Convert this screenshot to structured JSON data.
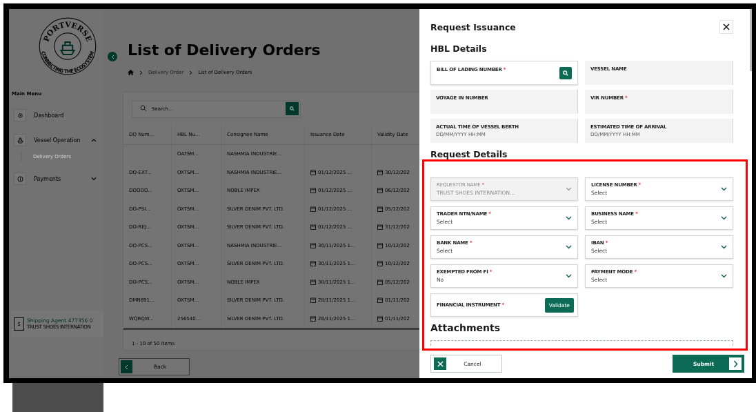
{
  "sidebar": {
    "logo": {
      "top_text": "PORTVERSE",
      "bottom_text": "CONNECTING THE ECOSYSTEM"
    },
    "menu_title": "Main Menu",
    "items": [
      {
        "label": "Dashboard",
        "kind": "dashboard"
      },
      {
        "label": "Vessel Operation",
        "kind": "ship",
        "expanded": true,
        "children": [
          {
            "label": "Delivery Orders"
          }
        ]
      },
      {
        "label": "Payments",
        "kind": "payment",
        "expanded": false
      }
    ],
    "user": {
      "avatar": "s",
      "name": "Shipping Agent 477356 0",
      "company": "TRUST SHOES INTERNATION"
    }
  },
  "page": {
    "title": "List of Delivery Orders",
    "breadcrumb": [
      "Delivery Order",
      "List of Delivery Orders"
    ],
    "search": {
      "placeholder": "Search..."
    },
    "table": {
      "columns": [
        "DO Num...",
        "HBL Nu...",
        "Consignee Name",
        "Issuance Date",
        "Validity Date"
      ],
      "rows": [
        {
          "hbl_number": "OATSM...",
          "consignee": "NASHMIA INDUSTRIE..."
        },
        {
          "do_number": "DO-EXT...",
          "hbl_number": "OXTSM...",
          "consignee": "NASHMIA INDUSTRIE...",
          "issuance_date": "01/12/2025 ...",
          "validity_date": "30/12/202"
        },
        {
          "do_number": "DOOOO...",
          "hbl_number": "OXTSM...",
          "consignee": "NOBLE IMPEX",
          "issuance_date": "01/12/2025 ...",
          "validity_date": "06/12/202"
        },
        {
          "do_number": "DO-PSI...",
          "hbl_number": "OXTSM...",
          "consignee": "SILVER DENIM PVT. LTD.",
          "issuance_date": "01/12/2025 ...",
          "validity_date": "05/12/202"
        },
        {
          "do_number": "DO-REJ...",
          "hbl_number": "OXTSM...",
          "consignee": "SILVER DENIM PVT. LTD.",
          "issuance_date": "01/12/2025 ...",
          "validity_date": "31/12/202"
        },
        {
          "do_number": "DO-PCS...",
          "hbl_number": "OXTSM...",
          "consignee": "NASHMIA INDUSTRIE...",
          "issuance_date": "30/11/2025 1...",
          "validity_date": "10/12/202"
        },
        {
          "do_number": "DO-PCS...",
          "hbl_number": "OXTSM...",
          "consignee": "SILVER DENIM PVT. LTD.",
          "issuance_date": "30/11/2025 1...",
          "validity_date": "10/12/202"
        },
        {
          "do_number": "DO-PCS...",
          "hbl_number": "OXTSM...",
          "consignee": "NOBLE IMPEX",
          "issuance_date": "30/11/2025 1...",
          "validity_date": "05/12/202"
        },
        {
          "do_number": "DMN891...",
          "hbl_number": "OXTSM...",
          "consignee": "SILVER DENIM PVT. LTD.",
          "issuance_date": "28/11/2025 1...",
          "validity_date": "01/11/202"
        },
        {
          "do_number": "WQRQW...",
          "hbl_number": "256540...",
          "consignee": "SILVER DENIM PVT. LTD.",
          "issuance_date": "28/11/2025 1...",
          "validity_date": "01/11/202"
        }
      ]
    },
    "pagination": "1 - 10 of 50 items",
    "back_button": "Back"
  },
  "panel": {
    "title": "Request Issuance",
    "hbl_title": "HBL Details",
    "hbl_fields": [
      {
        "kind": "search",
        "label": "BILL OF LADING NUMBER",
        "required_mark": "*"
      },
      {
        "kind": "readonly",
        "label": "VESSEL NAME"
      },
      {
        "kind": "readonly",
        "label": "VOYAGE IN NUMBER"
      },
      {
        "kind": "readonly",
        "label": "VIR NUMBER",
        "required_mark": "*"
      },
      {
        "kind": "readonly",
        "label": "ACTUAL TIME OF VESSEL BERTH",
        "placeholder": "DD/MM/YYYY HH:MM"
      },
      {
        "kind": "readonly",
        "label": "ESTIMATED TIME OF ARRIVAL",
        "placeholder": "DD/MM/YYYY HH:MM"
      }
    ],
    "request_title": "Request Details",
    "request_fields": [
      {
        "kind": "select",
        "label": "REQUESTOR NAME",
        "required_mark": "*",
        "value": "TRUST SHOES INTERNATION...",
        "disabled": true
      },
      {
        "kind": "select",
        "label": "LICENSE NUMBER",
        "required_mark": "*",
        "value": "Select",
        "disabled": false
      },
      {
        "kind": "select",
        "label": "TRADER NTN/NAME",
        "required_mark": "*",
        "value": "Select",
        "disabled": false
      },
      {
        "kind": "select",
        "label": "BUSINESS NAME",
        "required_mark": "*",
        "value": "Select",
        "disabled": false
      },
      {
        "kind": "select",
        "label": "BANK NAME",
        "required_mark": "*",
        "value": "Select",
        "disabled": false
      },
      {
        "kind": "select",
        "label": "IBAN",
        "required_mark": "*",
        "value": "Select",
        "disabled": false
      },
      {
        "kind": "select",
        "label": "EXEMPTED FROM FI",
        "required_mark": "*",
        "value": "No",
        "disabled": false
      },
      {
        "kind": "select",
        "label": "PAYMENT MODE",
        "required_mark": "*",
        "value": "Select",
        "disabled": false
      },
      {
        "kind": "validate",
        "label": "FINANCIAL INSTRUMENT",
        "required_mark": "*",
        "button": "Validate"
      }
    ],
    "attachments_title": "Attachments",
    "cancel_button": "Cancel",
    "submit_button": "Submit"
  }
}
